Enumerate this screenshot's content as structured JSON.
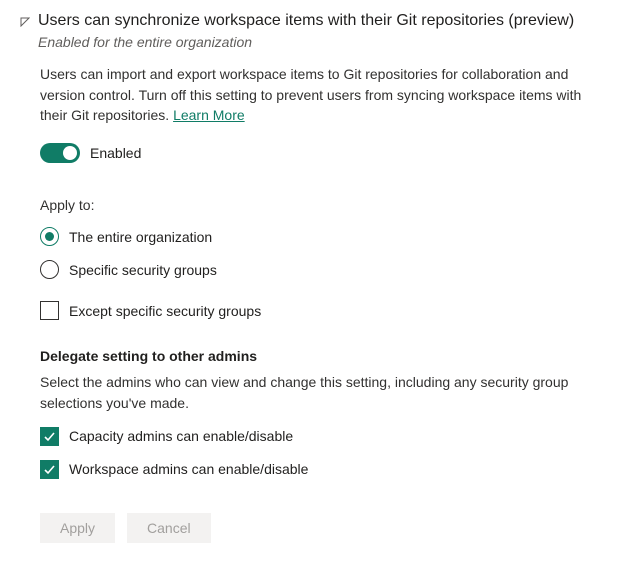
{
  "header": {
    "title": "Users can synchronize workspace items with their Git repositories (preview)",
    "subtitle": "Enabled for the entire organization"
  },
  "description": {
    "text": "Users can import and export workspace items to Git repositories for collaboration and version control. Turn off this setting to prevent users from syncing workspace items with their Git repositories. ",
    "learn_more": "Learn More"
  },
  "toggle": {
    "label": "Enabled"
  },
  "apply": {
    "label": "Apply to:",
    "options": [
      {
        "label": "The entire organization"
      },
      {
        "label": "Specific security groups"
      }
    ],
    "except": {
      "label": "Except specific security groups"
    }
  },
  "delegate": {
    "heading": "Delegate setting to other admins",
    "desc": "Select the admins who can view and change this setting, including any security group selections you've made.",
    "options": [
      {
        "label": "Capacity admins can enable/disable"
      },
      {
        "label": "Workspace admins can enable/disable"
      }
    ]
  },
  "buttons": {
    "apply": "Apply",
    "cancel": "Cancel"
  }
}
